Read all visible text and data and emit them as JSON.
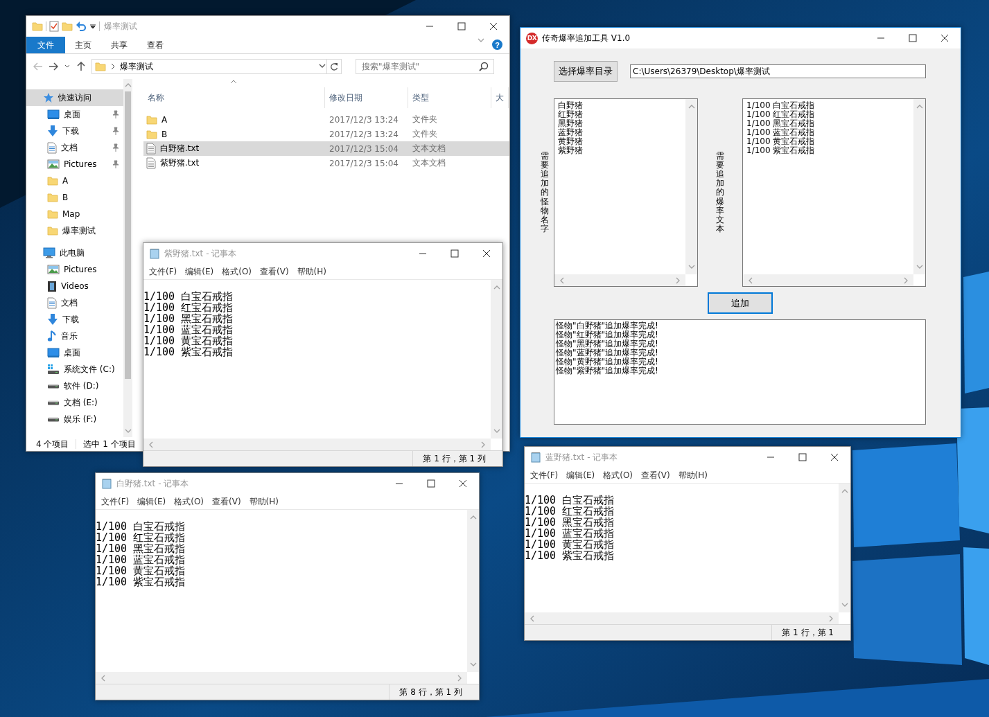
{
  "explorer": {
    "title": "爆率测试",
    "ribbon_tabs": [
      {
        "label": "文件",
        "selected": true
      },
      {
        "label": "主页",
        "selected": false
      },
      {
        "label": "共享",
        "selected": false
      },
      {
        "label": "查看",
        "selected": false
      }
    ],
    "help": "?",
    "address": "爆率测试",
    "search_placeholder": "搜索\"爆率测试\"",
    "sidebar": [
      {
        "label": "快速访问",
        "kind": "star",
        "selected": true,
        "children": [
          {
            "label": "桌面",
            "kind": "desktop",
            "pinned": true,
            "selected": false
          },
          {
            "label": "下载",
            "kind": "download",
            "pinned": true,
            "selected": false
          },
          {
            "label": "文档",
            "kind": "document",
            "pinned": true,
            "selected": false
          },
          {
            "label": "Pictures",
            "kind": "pictures",
            "pinned": true,
            "selected": false
          },
          {
            "label": "A",
            "kind": "folder",
            "pinned": false,
            "selected": false
          },
          {
            "label": "B",
            "kind": "folder",
            "pinned": false,
            "selected": false
          },
          {
            "label": "Map",
            "kind": "folder",
            "pinned": false,
            "selected": false
          },
          {
            "label": "爆率测试",
            "kind": "folder",
            "pinned": false,
            "selected": false
          }
        ]
      },
      {
        "label": "此电脑",
        "kind": "pc",
        "selected": false,
        "children": [
          {
            "label": "Pictures",
            "kind": "pictures",
            "pinned": false,
            "selected": false
          },
          {
            "label": "Videos",
            "kind": "videos",
            "pinned": false,
            "selected": false
          },
          {
            "label": "文档",
            "kind": "document",
            "pinned": false,
            "selected": false
          },
          {
            "label": "下载",
            "kind": "download",
            "pinned": false,
            "selected": false
          },
          {
            "label": "音乐",
            "kind": "music",
            "pinned": false,
            "selected": false
          },
          {
            "label": "桌面",
            "kind": "desktop",
            "pinned": false,
            "selected": false
          },
          {
            "label": "系统文件 (C:)",
            "kind": "system-drive",
            "pinned": false,
            "selected": false
          },
          {
            "label": "软件 (D:)",
            "kind": "drive",
            "pinned": false,
            "selected": false
          },
          {
            "label": "文档 (E:)",
            "kind": "drive",
            "pinned": false,
            "selected": false
          },
          {
            "label": "娱乐 (F:)",
            "kind": "drive",
            "pinned": false,
            "selected": false
          }
        ]
      }
    ],
    "columns": [
      "名称",
      "修改日期",
      "类型",
      "大"
    ],
    "files": [
      {
        "name": "A",
        "date": "2017/12/3 13:24",
        "type": "文件夹",
        "kind": "folder",
        "selected": false
      },
      {
        "name": "B",
        "date": "2017/12/3 13:24",
        "type": "文件夹",
        "kind": "folder",
        "selected": false
      },
      {
        "name": "白野猪.txt",
        "date": "2017/12/3 15:04",
        "type": "文本文档",
        "kind": "text",
        "selected": true
      },
      {
        "name": "紫野猪.txt",
        "date": "2017/12/3 15:04",
        "type": "文本文档",
        "kind": "text",
        "selected": false
      }
    ],
    "status_bar": [
      "4 个项目",
      "选中 1 个项目"
    ]
  },
  "tool": {
    "app_icon": "DX",
    "title": "传奇爆率追加工具 V1.0",
    "choose_button": "选择爆率目录",
    "path": "C:\\Users\\26379\\Desktop\\爆率测试",
    "monster_label": "需要追加的怪物名字",
    "monsters": [
      "白野猪",
      "红野猪",
      "黑野猪",
      "蓝野猪",
      "黄野猪",
      "紫野猪"
    ],
    "drop_label": "需要追加的爆率文本",
    "drops": [
      "1/100 白宝石戒指",
      "1/100 红宝石戒指",
      "1/100 黑宝石戒指",
      "1/100 蓝宝石戒指",
      "1/100 黄宝石戒指",
      "1/100 紫宝石戒指"
    ],
    "add_button": "追加",
    "log": [
      "怪物\"白野猪\"追加爆率完成!",
      "怪物\"红野猪\"追加爆率完成!",
      "怪物\"黑野猪\"追加爆率完成!",
      "怪物\"蓝野猪\"追加爆率完成!",
      "怪物\"黄野猪\"追加爆率完成!",
      "怪物\"紫野猪\"追加爆率完成!"
    ]
  },
  "notepads": [
    {
      "title": "紫野猪.txt - 记事本",
      "menu": [
        "文件(F)",
        "编辑(E)",
        "格式(O)",
        "查看(V)",
        "帮助(H)"
      ],
      "lines": [
        "1/100 白宝石戒指",
        "1/100 红宝石戒指",
        "1/100 黑宝石戒指",
        "1/100 蓝宝石戒指",
        "1/100 黄宝石戒指",
        "1/100 紫宝石戒指"
      ],
      "status": "第 1 行，第 1 列"
    },
    {
      "title": "白野猪.txt - 记事本",
      "menu": [
        "文件(F)",
        "编辑(E)",
        "格式(O)",
        "查看(V)",
        "帮助(H)"
      ],
      "lines": [
        "1/100 白宝石戒指",
        "1/100 红宝石戒指",
        "1/100 黑宝石戒指",
        "1/100 蓝宝石戒指",
        "1/100 黄宝石戒指",
        "1/100 紫宝石戒指"
      ],
      "status": "第 8 行，第 1 列"
    },
    {
      "title": "蓝野猪.txt - 记事本",
      "menu": [
        "文件(F)",
        "编辑(E)",
        "格式(O)",
        "查看(V)",
        "帮助(H)"
      ],
      "lines": [
        "1/100 白宝石戒指",
        "1/100 红宝石戒指",
        "1/100 黑宝石戒指",
        "1/100 蓝宝石戒指",
        "1/100 黄宝石戒指",
        "1/100 紫宝石戒指"
      ],
      "status": "第 1 行，第 1"
    }
  ]
}
